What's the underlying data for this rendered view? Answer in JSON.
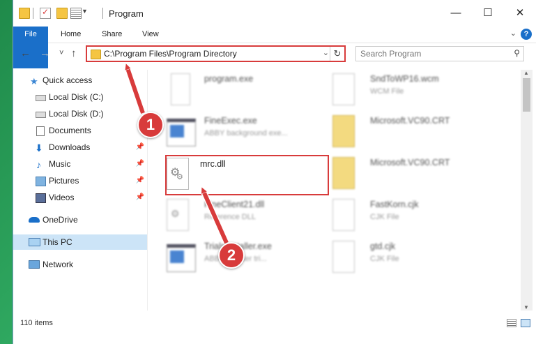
{
  "window": {
    "title": "Program",
    "minimize": "—",
    "maximize": "☐",
    "close": "✕"
  },
  "ribbon": {
    "tabs": [
      "File",
      "Home",
      "Share",
      "View"
    ],
    "help": "?"
  },
  "address": {
    "path": "C:\\Program Files\\Program Directory",
    "refresh": "↻"
  },
  "search": {
    "placeholder": "Search Program"
  },
  "nav": {
    "back": "←",
    "forward": "→",
    "recent": "˅",
    "up": "↑"
  },
  "sidebar": {
    "items": [
      {
        "label": "Quick access",
        "icon": "star-icon"
      },
      {
        "label": "Local Disk (C:)",
        "icon": "drive-icon"
      },
      {
        "label": "Local Disk (D:)",
        "icon": "drive-icon"
      },
      {
        "label": "Documents",
        "icon": "documents-icon"
      },
      {
        "label": "Downloads",
        "icon": "downloads-icon",
        "pinned": true
      },
      {
        "label": "Music",
        "icon": "music-icon",
        "pinned": true
      },
      {
        "label": "Pictures",
        "icon": "pictures-icon",
        "pinned": true
      },
      {
        "label": "Videos",
        "icon": "videos-icon",
        "pinned": true
      },
      {
        "label": "OneDrive",
        "icon": "onedrive-icon"
      },
      {
        "label": "This PC",
        "icon": "this-pc-icon",
        "selected": true
      },
      {
        "label": "Network",
        "icon": "network-icon"
      }
    ]
  },
  "files": [
    {
      "name": "program.exe",
      "sub": "",
      "blurred": true
    },
    {
      "name": "SndToWP16.wcm",
      "sub": "WCM File",
      "blurred": true
    },
    {
      "name": "FineExec.exe",
      "sub": "ABBY background exe...",
      "blurred": true
    },
    {
      "name": "Microsoft.VC90.CRT",
      "sub": "",
      "blurred": true
    },
    {
      "name": "mrc.dll",
      "sub": "",
      "blurred": false
    },
    {
      "name": "Microsoft.VC90.CRT",
      "sub": "",
      "blurred": true
    },
    {
      "name": "FineClient21.dll",
      "sub": "Reference DLL",
      "blurred": true
    },
    {
      "name": "FastKorn.cjk",
      "sub": "CJK File",
      "blurred": true
    },
    {
      "name": "TrialsInstaller.exe",
      "sub": "ABBY Reader tri...",
      "blurred": true
    },
    {
      "name": "gtd.cjk",
      "sub": "CJK File",
      "blurred": true
    }
  ],
  "status": {
    "count": "110 items"
  },
  "annotations": {
    "step1": "1",
    "step2": "2",
    "color": "#d83b3b"
  }
}
